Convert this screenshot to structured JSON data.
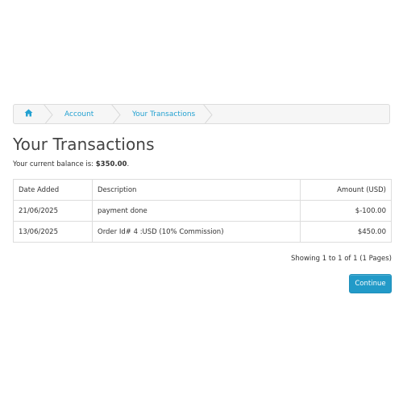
{
  "breadcrumb": {
    "home_icon": "home-icon",
    "items": [
      {
        "label": "Account"
      },
      {
        "label": "Your Transactions"
      }
    ]
  },
  "page": {
    "title": "Your Transactions",
    "balance_label": "Your current balance is:",
    "balance_value": "$350.00",
    "balance_suffix": "."
  },
  "table": {
    "headers": [
      "Date Added",
      "Description",
      "Amount (USD)"
    ],
    "rows": [
      {
        "date": "21/06/2025",
        "description": "payment done",
        "amount": "$-100.00"
      },
      {
        "date": "13/06/2025",
        "description": "Order Id# 4 :USD (10% Commission)",
        "amount": "$450.00"
      }
    ]
  },
  "pagination": {
    "text": "Showing 1 to 1 of 1 (1 Pages)"
  },
  "actions": {
    "continue_label": "Continue"
  },
  "colors": {
    "accent": "#229ac8",
    "link": "#23a1d1"
  }
}
